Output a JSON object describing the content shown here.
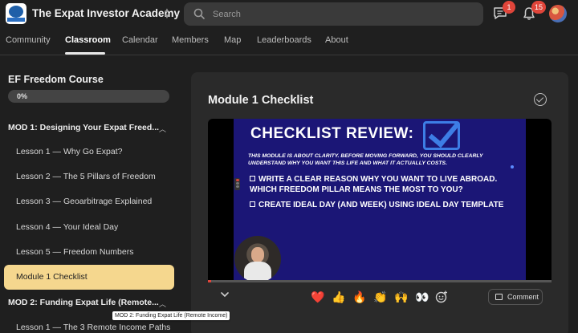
{
  "header": {
    "app_title": "The Expat Investor Academy",
    "logo_text": "EXPAT",
    "search_placeholder": "Search",
    "chat_badge": "1",
    "notifications_badge": "15"
  },
  "nav": {
    "tabs": [
      {
        "label": "Community"
      },
      {
        "label": "Classroom",
        "active": true
      },
      {
        "label": "Calendar"
      },
      {
        "label": "Members"
      },
      {
        "label": "Map"
      },
      {
        "label": "Leaderboards"
      },
      {
        "label": "About"
      }
    ]
  },
  "sidebar": {
    "course_title": "EF Freedom Course",
    "progress_label": "0%",
    "progress_fraction": 0,
    "modules": [
      {
        "title": "MOD 1: Designing Your Expat Freed...",
        "lessons": [
          {
            "label": "Lesson 1 — Why Go Expat?"
          },
          {
            "label": "Lesson 2 — The 5 Pillars of Freedom"
          },
          {
            "label": "Lesson 3 — Geoarbitrage Explained"
          },
          {
            "label": "Lesson 4 — Your Ideal Day"
          },
          {
            "label": "Lesson 5 — Freedom Numbers"
          },
          {
            "label": "Module 1 Checklist",
            "active": true
          }
        ]
      },
      {
        "title": "MOD 2: Funding Expat Life (Remote...",
        "lessons": [
          {
            "label": "Lesson 1 — The 3 Remote Income Paths"
          }
        ]
      }
    ],
    "tooltip": "MOD 2: Funding Expat Life (Remote Income)"
  },
  "main": {
    "title": "Module 1 Checklist",
    "video": {
      "slide_title": "CHECKLIST REVIEW:",
      "slide_intro": "THIS MODULE IS ABOUT CLARITY. BEFORE MOVING FORWARD, YOU SHOULD CLEARLY UNDERSTAND WHY YOU WANT THIS LIFE AND WHAT IT ACTUALLY COSTS.",
      "item_1": "WRITE A CLEAR REASON WHY YOU WANT TO LIVE ABROAD. WHICH FREEDOM PILLAR MEANS THE MOST TO YOU?",
      "item_2": "CREATE IDEAL DAY (AND WEEK) USING IDEAL DAY TEMPLATE",
      "played_fraction": 0.01
    },
    "reactions": [
      "❤️",
      "👍",
      "🔥",
      "👏",
      "🙌",
      "👀"
    ],
    "comment_label": "Comment"
  },
  "colors": {
    "background": "#1f1f1f",
    "panel": "#2a2a2a",
    "active_lesson": "#f5d78e",
    "badge": "#e0453a",
    "slide": "#1b1676",
    "slide_accent": "#3d7ee6"
  }
}
